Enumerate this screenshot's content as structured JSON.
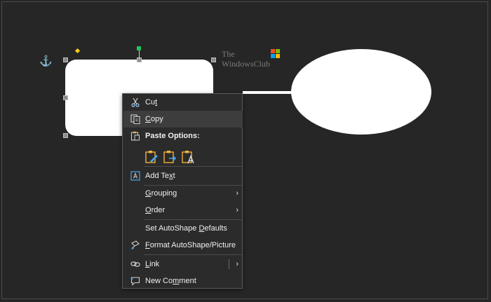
{
  "watermark": {
    "line1": "The",
    "line2": "WindowsClub"
  },
  "colors": {
    "background": "#262626",
    "menu_bg": "#2b2b2b",
    "rotation_handle": "#22c55e",
    "adjust_handle": "#f6d10a",
    "anchor": "#3b82f6",
    "icon_blue": "#4aa3e8",
    "icon_orange": "#f0b23a"
  },
  "icons": {
    "anchor": "anchor-icon",
    "cut": "scissors-icon",
    "copy": "copy-icon",
    "paste": "clipboard-icon",
    "add_text": "text-box-icon",
    "format": "format-paint-icon",
    "link": "link-icon",
    "comment": "comment-icon"
  },
  "context_menu": {
    "cut": {
      "pre": "Cu",
      "key": "t",
      "post": ""
    },
    "copy": {
      "pre": "",
      "key": "C",
      "post": "opy"
    },
    "paste_options": {
      "pre": "Paste Options:",
      "key": "",
      "post": ""
    },
    "add_text": {
      "pre": "Add Te",
      "key": "x",
      "post": "t"
    },
    "grouping": {
      "pre": "",
      "key": "G",
      "post": "rouping"
    },
    "order": {
      "pre": "",
      "key": "O",
      "post": "rder"
    },
    "set_defaults": {
      "pre": "Set AutoShape ",
      "key": "D",
      "post": "efaults"
    },
    "format": {
      "pre": "",
      "key": "F",
      "post": "ormat AutoShape/Picture"
    },
    "link": {
      "pre": "",
      "key": "L",
      "post": "ink"
    },
    "new_comment": {
      "pre": "New Co",
      "key": "m",
      "post": "ment"
    },
    "submenu_arrow": "›"
  }
}
